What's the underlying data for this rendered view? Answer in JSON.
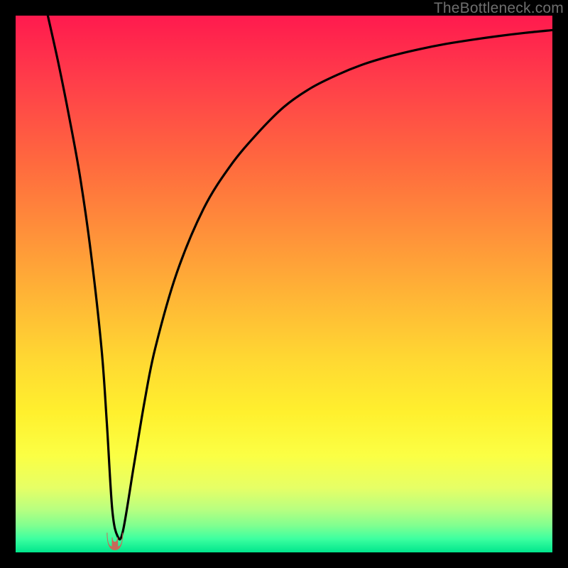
{
  "watermark": "TheBottleneck.com",
  "chart_data": {
    "type": "line",
    "title": "",
    "xlabel": "",
    "ylabel": "",
    "xlim": [
      0,
      100
    ],
    "ylim": [
      0,
      100
    ],
    "background_gradient": {
      "top": "#ff1a4e",
      "mid": "#fff02e",
      "bottom": "#00e68c"
    },
    "series": [
      {
        "name": "bottleneck-curve",
        "x": [
          6,
          8,
          10,
          12,
          14,
          16,
          17,
          18,
          19,
          20,
          22,
          24,
          26,
          30,
          35,
          40,
          45,
          50,
          55,
          60,
          65,
          70,
          75,
          80,
          85,
          90,
          95,
          100
        ],
        "values": [
          100,
          91,
          81,
          70,
          56,
          38,
          24,
          8,
          3,
          4,
          16,
          28,
          38,
          52,
          64,
          72,
          78,
          83,
          86.5,
          89,
          91,
          92.5,
          93.7,
          94.7,
          95.5,
          96.2,
          96.8,
          97.3
        ]
      }
    ],
    "marker": {
      "name": "optimal-point",
      "x": 18.5,
      "y": 2.5,
      "color": "#c76a5a"
    }
  }
}
